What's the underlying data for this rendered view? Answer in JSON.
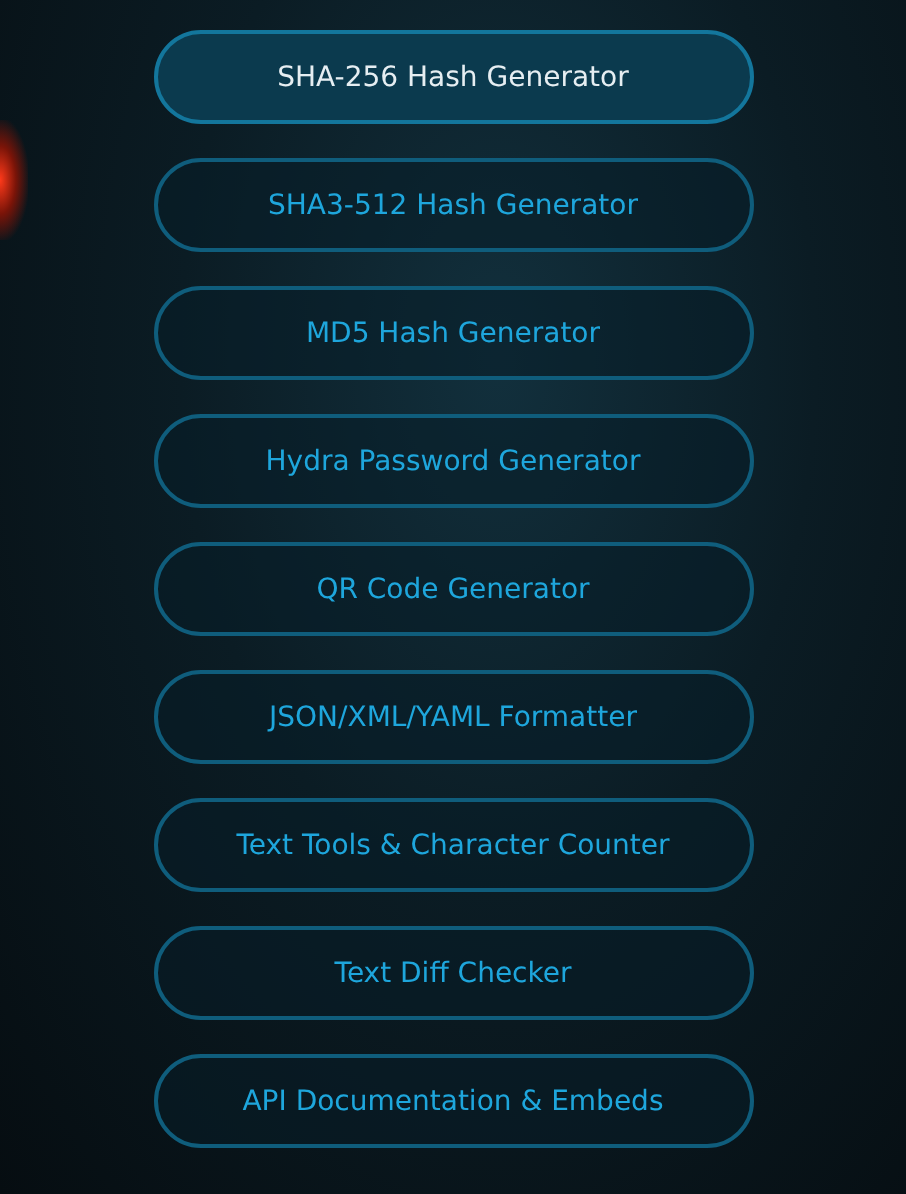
{
  "menu": [
    {
      "label": "SHA-256 Hash Generator",
      "selected": true
    },
    {
      "label": "SHA3-512 Hash Generator",
      "selected": false
    },
    {
      "label": "MD5 Hash Generator",
      "selected": false
    },
    {
      "label": "Hydra Password Generator",
      "selected": false
    },
    {
      "label": "QR Code Generator",
      "selected": false
    },
    {
      "label": "JSON/XML/YAML Formatter",
      "selected": false
    },
    {
      "label": "Text Tools & Character Counter",
      "selected": false
    },
    {
      "label": "Text Diff Checker",
      "selected": false
    },
    {
      "label": "API Documentation & Embeds",
      "selected": false
    }
  ]
}
